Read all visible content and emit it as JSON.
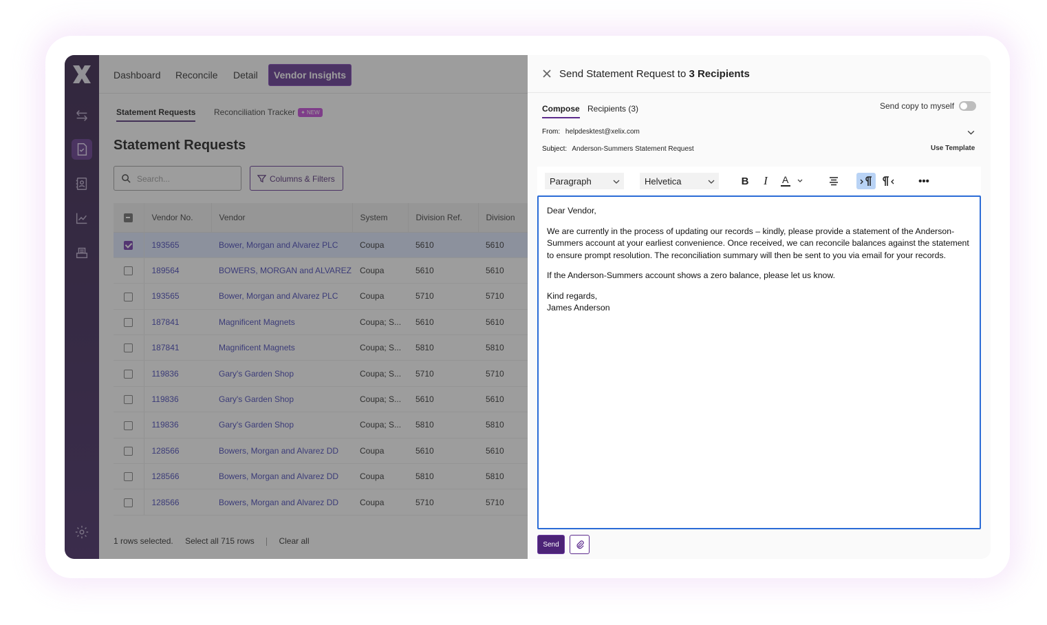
{
  "nav": {
    "items": [
      "Dashboard",
      "Reconcile",
      "Detail",
      "Vendor Insights"
    ],
    "active": "Vendor Insights"
  },
  "subtabs": {
    "statement": "Statement Requests",
    "tracker": "Reconciliation Tracker",
    "new_badge": "NEW"
  },
  "page_title": "Statement Requests",
  "search": {
    "placeholder": "Search..."
  },
  "columns_filters": "Columns & Filters",
  "table": {
    "headers": [
      "Vendor No.",
      "Vendor",
      "System",
      "Division Ref.",
      "Division"
    ],
    "rows": [
      {
        "vno": "193565",
        "vendor": "Bower, Morgan and Alvarez PLC",
        "system": "Coupa",
        "divref": "5610",
        "div": "5610",
        "checked": true
      },
      {
        "vno": "189564",
        "vendor": "BOWERS, MORGAN and ALVAREZ",
        "system": "Coupa",
        "divref": "5610",
        "div": "5610",
        "checked": false
      },
      {
        "vno": "193565",
        "vendor": "Bower, Morgan and Alvarez PLC",
        "system": "Coupa",
        "divref": "5710",
        "div": "5710",
        "checked": false
      },
      {
        "vno": "187841",
        "vendor": "Magnificent Magnets",
        "system": "Coupa; S...",
        "divref": "5610",
        "div": "5610",
        "checked": false
      },
      {
        "vno": "187841",
        "vendor": "Magnificent Magnets",
        "system": "Coupa; S...",
        "divref": "5810",
        "div": "5810",
        "checked": false
      },
      {
        "vno": "119836",
        "vendor": "Gary's Garden Shop",
        "system": "Coupa; S...",
        "divref": "5710",
        "div": "5710",
        "checked": false
      },
      {
        "vno": "119836",
        "vendor": "Gary's Garden Shop",
        "system": "Coupa; S...",
        "divref": "5610",
        "div": "5610",
        "checked": false
      },
      {
        "vno": "119836",
        "vendor": "Gary's Garden Shop",
        "system": "Coupa; S...",
        "divref": "5810",
        "div": "5810",
        "checked": false
      },
      {
        "vno": "128566",
        "vendor": "Bowers, Morgan and Alvarez DD",
        "system": "Coupa",
        "divref": "5610",
        "div": "5610",
        "checked": false
      },
      {
        "vno": "128566",
        "vendor": "Bowers, Morgan and Alvarez DD",
        "system": "Coupa",
        "divref": "5810",
        "div": "5810",
        "checked": false
      },
      {
        "vno": "128566",
        "vendor": "Bowers, Morgan and Alvarez DD",
        "system": "Coupa",
        "divref": "5710",
        "div": "5710",
        "checked": false
      }
    ]
  },
  "footer": {
    "selected": "1 rows selected.",
    "select_all": "Select all 715 rows",
    "clear_all": "Clear all"
  },
  "panel": {
    "title_prefix": "Send Statement Request to",
    "title_bold": "3 Recipients",
    "tabs": [
      "Compose",
      "Recipients (3)"
    ],
    "copy_label": "Send copy to myself",
    "copy_enabled": false,
    "from_label": "From:",
    "from_value": "helpdesktest@xelix.com",
    "subject_label": "Subject:",
    "subject_value": "Anderson-Summers Statement Request",
    "use_template": "Use Template",
    "toolbar": {
      "block": "Paragraph",
      "font": "Helvetica"
    },
    "body": [
      "Dear Vendor,",
      "We are currently in the process of updating our records – kindly, please provide a statement of the Anderson-Summers account at your earliest convenience. Once received, we can reconcile balances against the statement to ensure prompt resolution. The reconciliation summary will then be sent to you via email for your records.",
      "If the Anderson-Summers account shows a zero balance, please let us know.",
      "Kind regards,",
      "James Anderson"
    ],
    "send": "Send"
  },
  "colors": {
    "brand": "#5b2a8c",
    "sidebar": "#2a1440",
    "editor_focus": "#2a6bd6",
    "link": "#3a3ab4"
  }
}
